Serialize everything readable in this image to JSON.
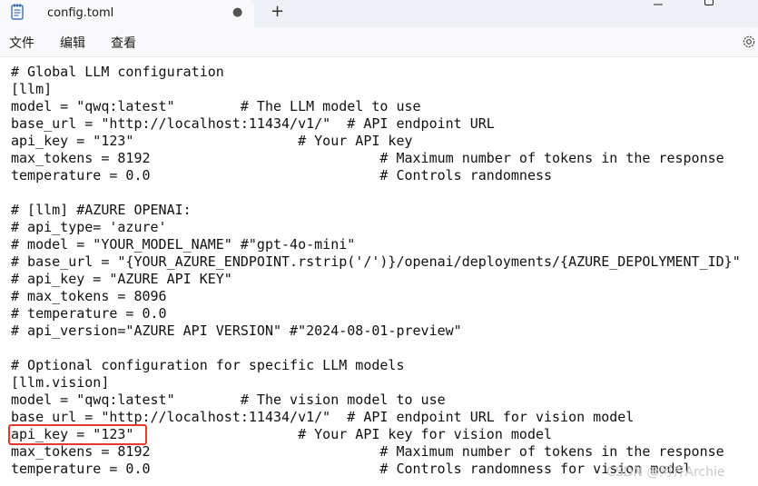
{
  "tab": {
    "title": "config.toml",
    "modified_indicator": "●"
  },
  "new_tab_label": "+",
  "menu": {
    "file": "文件",
    "edit": "编辑",
    "view": "查看"
  },
  "icons": {
    "document": "document-icon",
    "minimize": "minimize-icon",
    "maximize": "maximize-icon",
    "settings": "gear-icon"
  },
  "editor": {
    "lines": [
      "# Global LLM configuration",
      "[llm]",
      "model = \"qwq:latest\"        # The LLM model to use",
      "base_url = \"http://localhost:11434/v1/\"  # API endpoint URL",
      "api_key = \"123\"                    # Your API key",
      "max_tokens = 8192                            # Maximum number of tokens in the response",
      "temperature = 0.0                            # Controls randomness",
      "",
      "# [llm] #AZURE OPENAI:",
      "# api_type= 'azure'",
      "# model = \"YOUR_MODEL_NAME\" #\"gpt-4o-mini\"",
      "# base_url = \"{YOUR_AZURE_ENDPOINT.rstrip('/')}/openai/deployments/{AZURE_DEPOLYMENT_ID}\"",
      "# api_key = \"AZURE API KEY\"",
      "# max_tokens = 8096",
      "# temperature = 0.0",
      "# api_version=\"AZURE API VERSION\" #\"2024-08-01-preview\"",
      "",
      "# Optional configuration for specific LLM models",
      "[llm.vision]",
      "model = \"qwq:latest\"        # The vision model to use",
      "base_url = \"http://localhost:11434/v1/\"  # API endpoint URL for vision model",
      "api_key = \"123\"                    # Your API key for vision model",
      "max_tokens = 8192                            # Maximum number of tokens in the response",
      "temperature = 0.0                            # Controls randomness for vision model"
    ]
  },
  "watermark": "CSDN @阿齐Archie",
  "colors": {
    "highlight": "#e33b2e",
    "titlebar": "#eef1f6"
  }
}
